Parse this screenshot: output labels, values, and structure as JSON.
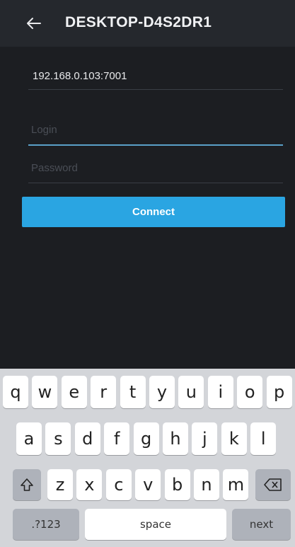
{
  "appbar": {
    "back_icon": "arrow-left-icon",
    "title": "DESKTOP-D4S2DR1"
  },
  "form": {
    "address_value": "192.168.0.103:7001",
    "login_placeholder": "Login",
    "password_placeholder": "Password",
    "connect_label": "Connect"
  },
  "keyboard": {
    "row1": [
      "q",
      "w",
      "e",
      "r",
      "t",
      "y",
      "u",
      "i",
      "o",
      "p"
    ],
    "row2": [
      "a",
      "s",
      "d",
      "f",
      "g",
      "h",
      "j",
      "k",
      "l"
    ],
    "row3": [
      "z",
      "x",
      "c",
      "v",
      "b",
      "n",
      "m"
    ],
    "symbols_label": ".?123",
    "space_label": "space",
    "next_label": "next",
    "shift_icon": "shift-icon",
    "backspace_icon": "backspace-icon"
  },
  "colors": {
    "background": "#1c1e22",
    "appbar": "#25282d",
    "accent": "#2aa5e2"
  }
}
